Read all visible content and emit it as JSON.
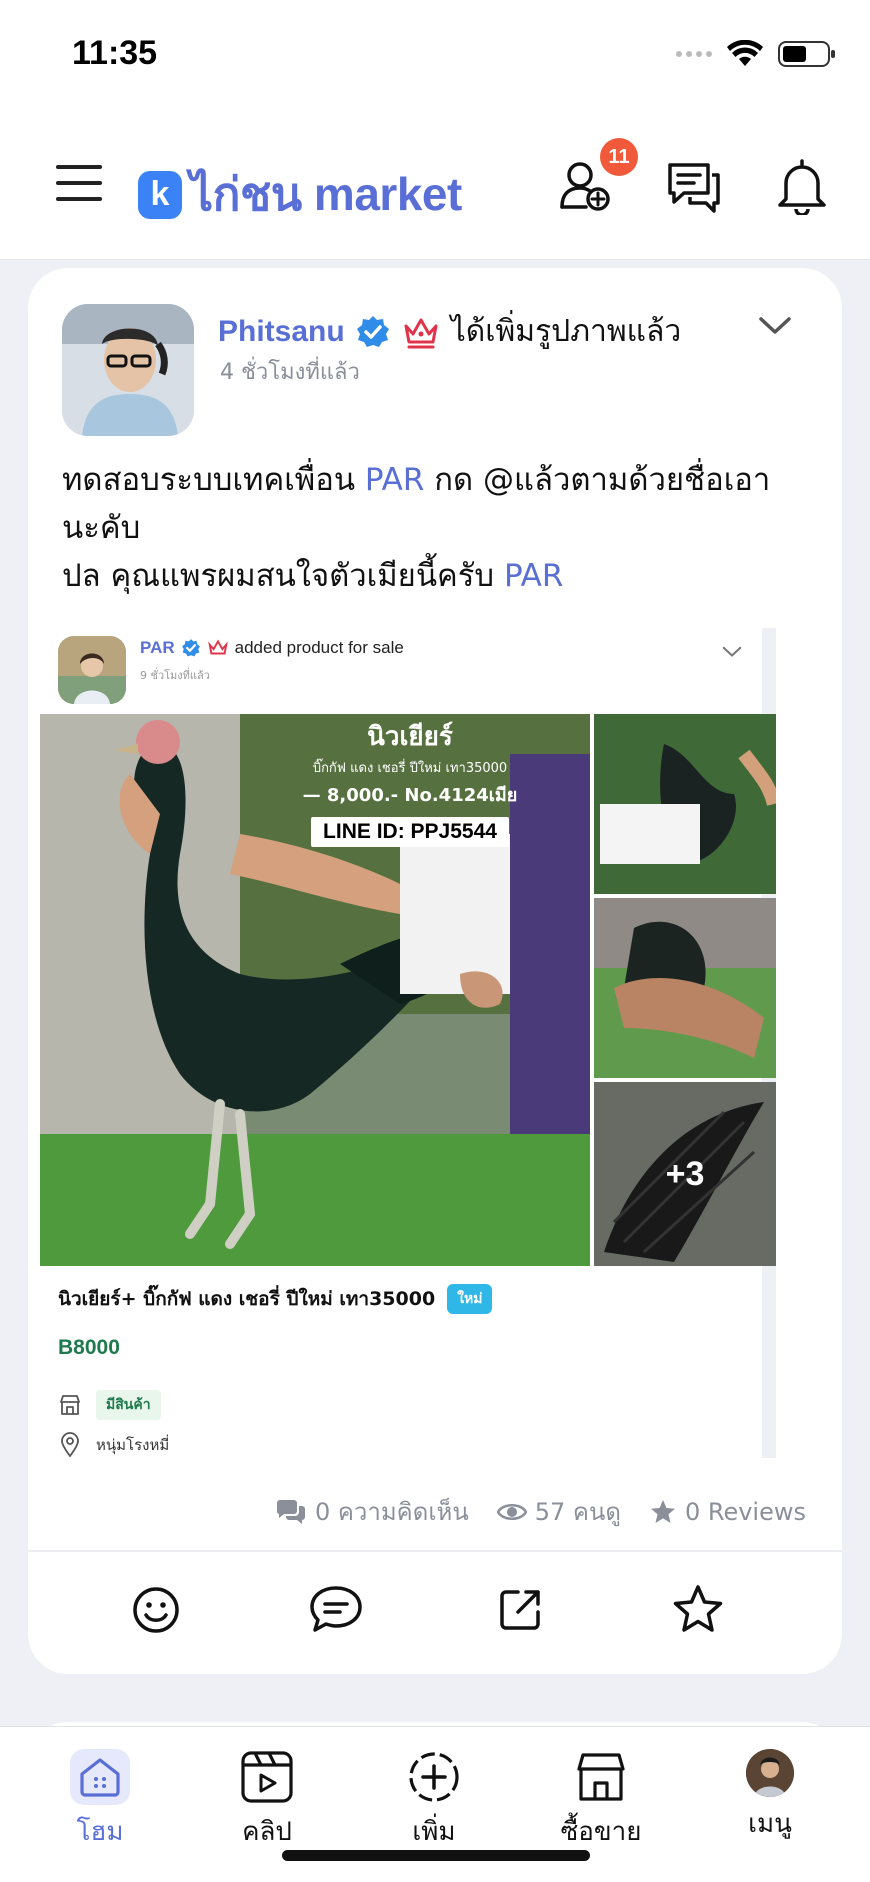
{
  "status_bar": {
    "time": "11:35"
  },
  "header": {
    "logo_mark": "k",
    "logo_text": "ไก่ชน market",
    "friend_badge_count": "11"
  },
  "post": {
    "author": "Phitsanu",
    "action": "ได้เพิ่มรูปภาพแล้ว",
    "time": "4 ชั่วโมงที่แล้ว",
    "body_line1_prefix": "ทดสอบระบบเทคเพื่อน ",
    "mention1": "PAR",
    "body_line1_suffix": " กด @แล้วตามด้วยชื่อเอา",
    "body_line2": "นะคับ",
    "body_line3_prefix": "ปล คุณแพรผมสนใจตัวเมียนี้ครับ ",
    "mention2": "PAR",
    "shared": {
      "author": "PAR",
      "action": "added product for sale",
      "time": "9 ชั่วโมงที่แล้ว",
      "image_overlay": {
        "title": "นิวเยียร์",
        "subtitle": "บิ๊กกัฟ แดง เชอรี่ ปีใหม่ เทา35000",
        "price_line": "— 8,000.- No.4124เมีย",
        "line_id": "LINE ID: PPJ5544"
      },
      "more_photos": "+3",
      "product_title": "นิวเยียร์+ บิ๊กกัฟ แดง เชอรี่ ปีใหม่ เทา35000",
      "new_tag": "ใหม่",
      "price": "B8000",
      "stock": "มีสินค้า",
      "location": "หนุ่มโรงหมี่"
    },
    "stats": {
      "comments": "0 ความคิดเห็น",
      "views": "57 คนดู",
      "reviews": "0 Reviews"
    }
  },
  "tabbar": {
    "home": "โฮม",
    "clip": "คลิป",
    "add": "เพิ่ม",
    "shop": "ซื้อขาย",
    "menu": "เมนู"
  },
  "colors": {
    "brand": "#5a6fd6",
    "badge": "#f05a3a",
    "price": "#1f7a4d",
    "new_tag": "#2fb7e8"
  }
}
